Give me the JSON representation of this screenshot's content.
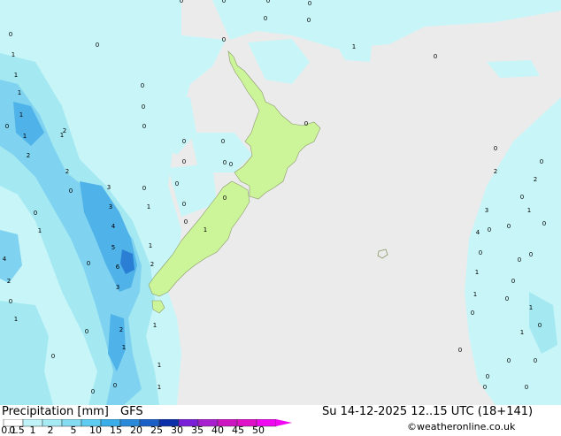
{
  "header": {
    "product_label": "Precipitation [mm]",
    "model_label": "GFS",
    "valid_time": "Su 14-12-2025 12..15 UTC (18+141)",
    "copyright": "©weatheronline.co.uk"
  },
  "legend": {
    "ticks": [
      "0.1",
      "0.5",
      "1",
      "2",
      "5",
      "10",
      "15",
      "20",
      "25",
      "30",
      "35",
      "40",
      "45",
      "50"
    ],
    "colors": [
      "#ffffff",
      "#bff3f8",
      "#a6eaf4",
      "#84dcf2",
      "#5ecbf0",
      "#3aaee8",
      "#2a89d8",
      "#1a5fc8",
      "#0b2fa8",
      "#7a1fd8",
      "#a81fd0",
      "#cc14c0",
      "#e010c8",
      "#f008f0"
    ]
  },
  "map": {
    "land_color": "#ccf59a",
    "sea_color": "#ebebeb",
    "region": "New Zealand",
    "values": [
      {
        "v": "0"
      },
      {
        "v": "0"
      },
      {
        "v": "0"
      },
      {
        "v": "0"
      },
      {
        "v": "0"
      },
      {
        "v": "0"
      },
      {
        "v": "0"
      },
      {
        "v": "0"
      },
      {
        "v": "1"
      },
      {
        "v": "1"
      },
      {
        "v": "1"
      },
      {
        "v": "1"
      },
      {
        "v": "2"
      },
      {
        "v": "1"
      },
      {
        "v": "2"
      },
      {
        "v": "2"
      },
      {
        "v": "0"
      },
      {
        "v": "0"
      },
      {
        "v": "3"
      },
      {
        "v": "3"
      },
      {
        "v": "1"
      },
      {
        "v": "4"
      },
      {
        "v": "1"
      },
      {
        "v": "5"
      },
      {
        "v": "6"
      },
      {
        "v": "2"
      },
      {
        "v": "3"
      },
      {
        "v": "0"
      },
      {
        "v": "1"
      },
      {
        "v": "0"
      },
      {
        "v": "4"
      },
      {
        "v": "2"
      },
      {
        "v": "1"
      },
      {
        "v": "1"
      },
      {
        "v": "2"
      },
      {
        "v": "1"
      },
      {
        "v": "1"
      },
      {
        "v": "1"
      },
      {
        "v": "0"
      },
      {
        "v": "0"
      },
      {
        "v": "0"
      },
      {
        "v": "0"
      },
      {
        "v": "1"
      },
      {
        "v": "0"
      },
      {
        "v": "0"
      },
      {
        "v": "0"
      },
      {
        "v": "0"
      },
      {
        "v": "0"
      },
      {
        "v": "0"
      },
      {
        "v": "0"
      },
      {
        "v": "0"
      },
      {
        "v": "0"
      },
      {
        "v": "0"
      },
      {
        "v": "0"
      },
      {
        "v": "0"
      },
      {
        "v": "0"
      },
      {
        "v": "1"
      },
      {
        "v": "2"
      },
      {
        "v": "2"
      },
      {
        "v": "3"
      },
      {
        "v": "4"
      },
      {
        "v": "1"
      },
      {
        "v": "1"
      },
      {
        "v": "0"
      },
      {
        "v": "0"
      },
      {
        "v": "0"
      },
      {
        "v": "0"
      },
      {
        "v": "0"
      },
      {
        "v": "1"
      },
      {
        "v": "0"
      },
      {
        "v": "0"
      },
      {
        "v": "0"
      },
      {
        "v": "0"
      },
      {
        "v": "0"
      },
      {
        "v": "0"
      },
      {
        "v": "0"
      },
      {
        "v": "0"
      },
      {
        "v": "0"
      },
      {
        "v": "0"
      },
      {
        "v": "0"
      },
      {
        "v": "0"
      },
      {
        "v": "1"
      },
      {
        "v": "0"
      },
      {
        "v": "0"
      },
      {
        "v": "1"
      },
      {
        "v": "0"
      },
      {
        "v": "0"
      },
      {
        "v": "1"
      },
      {
        "v": "0"
      },
      {
        "v": "0"
      }
    ]
  }
}
